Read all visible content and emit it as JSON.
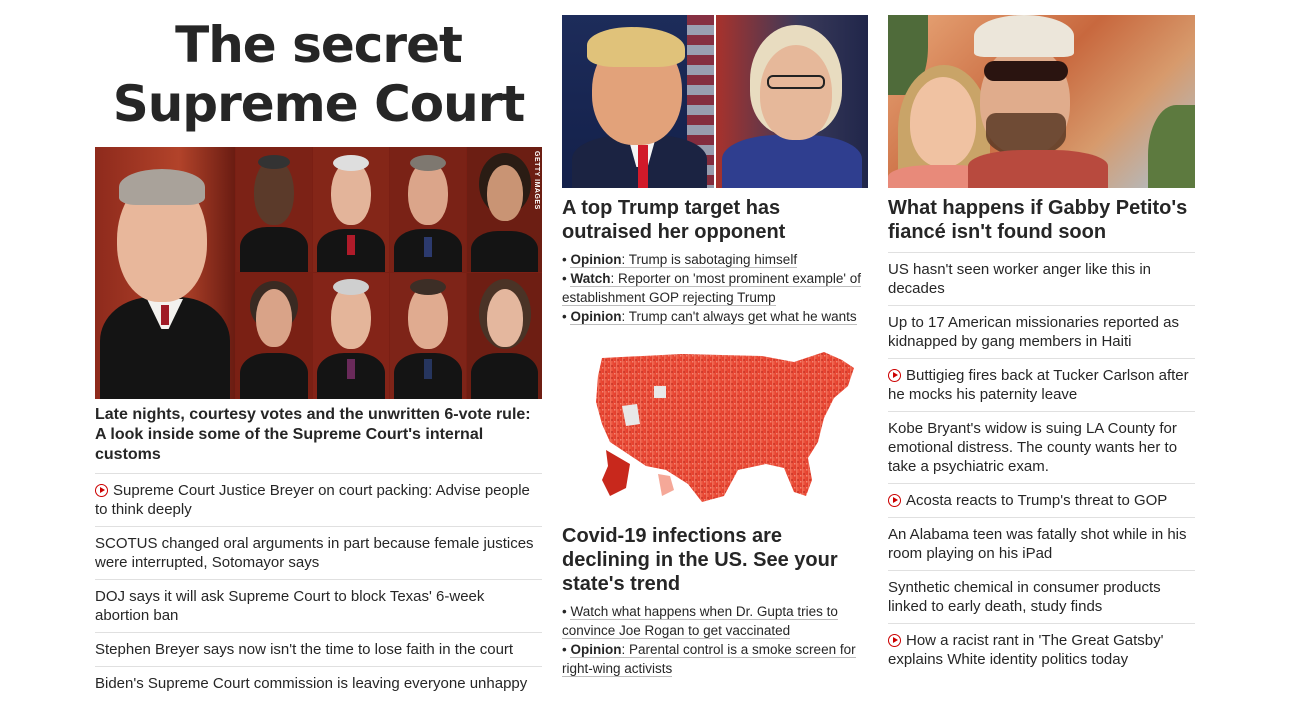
{
  "left": {
    "banner_line1": "The secret",
    "banner_line2": "Supreme Court",
    "photo_credit": "GETTY IMAGES",
    "lead": "Late nights, courtesy votes and the unwritten 6-vote rule: A look inside some of the Supreme Court's internal customs",
    "items": [
      {
        "text": "Supreme Court Justice Breyer on court packing: Advise people to think deeply",
        "video": true
      },
      {
        "text": "SCOTUS changed oral arguments in part because female justices were interrupted, Sotomayor says",
        "video": false
      },
      {
        "text": "DOJ says it will ask Supreme Court to block Texas' 6-week abortion ban",
        "video": false
      },
      {
        "text": "Stephen Breyer says now isn't the time to lose faith in the court",
        "video": false
      },
      {
        "text": "Biden's Supreme Court commission is leaving everyone unhappy",
        "video": false
      }
    ]
  },
  "middle": {
    "headline1": "A top Trump target has outraised her opponent",
    "sub1": [
      {
        "label": "Opinion",
        "text": ": Trump is sabotaging himself"
      },
      {
        "label": "Watch",
        "text": ": Reporter on 'most prominent example' of establishment GOP rejecting Trump"
      },
      {
        "label": "Opinion",
        "text": ": Trump can't always get what he wants"
      }
    ],
    "headline2": "Covid-19 infections are declining in the US. See your state's trend",
    "sub2": [
      {
        "label": "",
        "text": "Watch what happens when Dr. Gupta tries to convince Joe Rogan to get vaccinated"
      },
      {
        "label": "Opinion",
        "text": ": Parental control is a smoke screen for right-wing activists"
      }
    ]
  },
  "right": {
    "headline": "What happens if Gabby Petito's fiancé isn't found soon",
    "items": [
      {
        "text": "US hasn't seen worker anger like this in decades",
        "video": false
      },
      {
        "text": "Up to 17 American missionaries reported as kidnapped by gang members in Haiti",
        "video": false
      },
      {
        "text": "Buttigieg fires back at Tucker Carlson after he mocks his paternity leave",
        "video": true
      },
      {
        "text": "Kobe Bryant's widow is suing LA County for emotional distress. The county wants her to take a psychiatric exam.",
        "video": false
      },
      {
        "text": "Acosta reacts to Trump's threat to GOP",
        "video": true
      },
      {
        "text": "An Alabama teen was fatally shot while in his room playing on his iPad",
        "video": false
      },
      {
        "text": "Synthetic chemical in consumer products linked to early death, study finds",
        "video": false
      },
      {
        "text": "How a racist rant in 'The Great Gatsby' explains White identity politics today",
        "video": true
      }
    ]
  },
  "colors": {
    "accent": "#cc0000",
    "text": "#262626",
    "divider": "#e0e0e0"
  }
}
